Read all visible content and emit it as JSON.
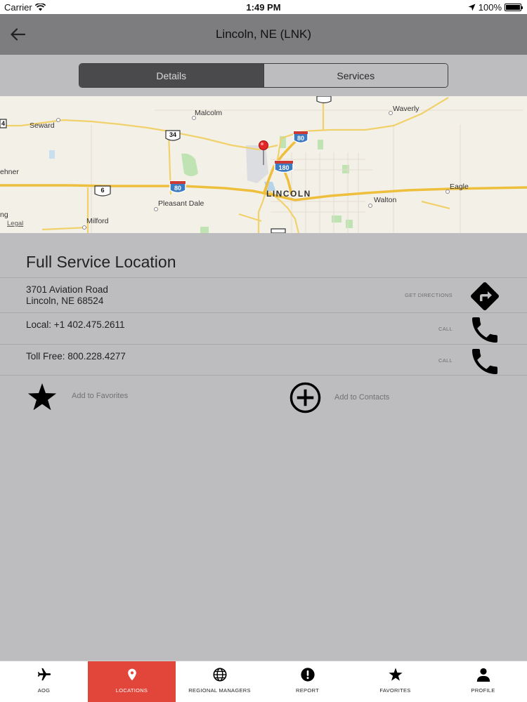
{
  "status_bar": {
    "carrier": "Carrier",
    "time": "1:49 PM",
    "battery": "100%"
  },
  "nav": {
    "title": "Lincoln, NE (LNK)"
  },
  "segments": [
    {
      "label": "Details",
      "selected": true
    },
    {
      "label": "Services",
      "selected": false
    }
  ],
  "map": {
    "labels": {
      "malcolm": "Malcolm",
      "waverly": "Waverly",
      "seward": "Seward",
      "ehner": "ehner",
      "lincoln": "LINCOLN",
      "eagle": "Eagle",
      "pleasant_dale": "Pleasant Dale",
      "walton": "Walton",
      "milford": "Milford",
      "legal": "Legal",
      "ng": "ng",
      "i80_a": "80",
      "i80_b": "80",
      "i180": "180",
      "us34": "34",
      "us6": "6",
      "left_shield": "4"
    }
  },
  "location": {
    "section_title": "Full Service Location",
    "address_line1": "3701 Aviation Road",
    "address_line2": "Lincoln, NE  68524",
    "directions_label": "GET DIRECTIONS",
    "local_phone": "Local: +1 402.475.2611",
    "local_call_label": "CALL",
    "toll_free": "Toll Free: 800.228.4277",
    "toll_call_label": "CALL",
    "add_favorites": "Add to Favorites",
    "add_contacts": "Add to Contacts"
  },
  "tabs": [
    {
      "label": "AOG",
      "icon": "airplane-icon",
      "active": false
    },
    {
      "label": "LOCATIONS",
      "icon": "map-pin-icon",
      "active": true
    },
    {
      "label": "REGIONAL MANAGERS",
      "icon": "globe-icon",
      "active": false
    },
    {
      "label": "REPORT",
      "icon": "alert-icon",
      "active": false
    },
    {
      "label": "FAVORITES",
      "icon": "star-icon",
      "active": false
    },
    {
      "label": "PROFILE",
      "icon": "person-icon",
      "active": false
    }
  ],
  "colors": {
    "accent": "#e2453a",
    "background": "#bdbcbf",
    "nav_bar": "#7d7c7f",
    "segment_active": "#4a4a4c"
  }
}
